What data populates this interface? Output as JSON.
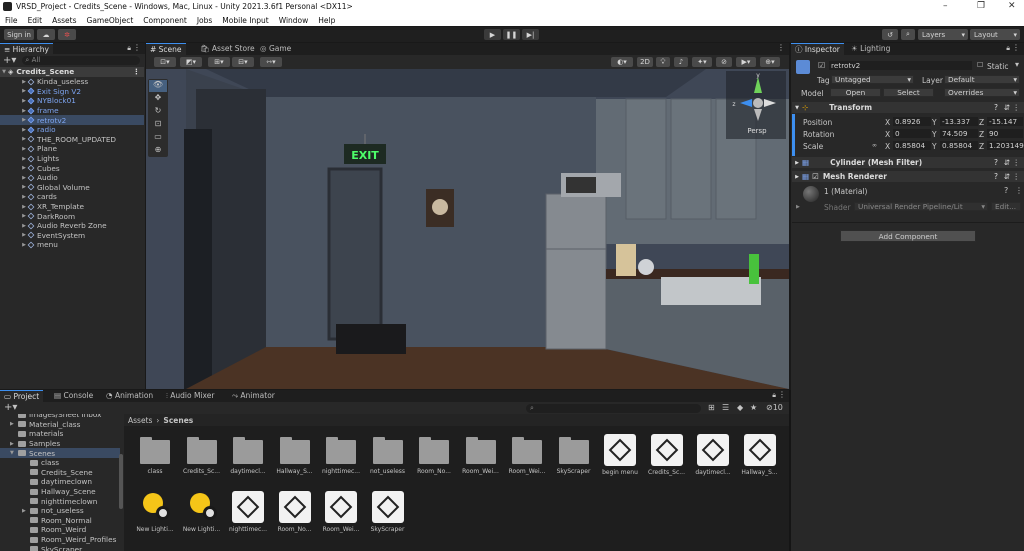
{
  "window": {
    "title": "VRSD_Project - Credits_Scene - Windows, Mac, Linux - Unity 2021.3.6f1 Personal <DX11>"
  },
  "menu": [
    "File",
    "Edit",
    "Assets",
    "GameObject",
    "Component",
    "Jobs",
    "Mobile Input",
    "Window",
    "Help"
  ],
  "toolbar": {
    "sign_in": "Sign in",
    "layers": "Layers",
    "layout": "Layout"
  },
  "hierarchy": {
    "tab": "Hierarchy",
    "search_placeholder": "All",
    "scene": "Credits_Scene",
    "items": [
      {
        "label": "Kinda_useless",
        "blue": false
      },
      {
        "label": "Exit Sign V2",
        "blue": true
      },
      {
        "label": "NYBlock01",
        "blue": true
      },
      {
        "label": "frame",
        "blue": true
      },
      {
        "label": "retrotv2",
        "blue": true,
        "selected": true
      },
      {
        "label": "radio",
        "blue": true
      },
      {
        "label": "THE_ROOM_UPDATED",
        "blue": false
      },
      {
        "label": "Plane",
        "blue": false
      },
      {
        "label": "Lights",
        "blue": false
      },
      {
        "label": "Cubes",
        "blue": false
      },
      {
        "label": "Audio",
        "blue": false
      },
      {
        "label": "Global Volume",
        "blue": false
      },
      {
        "label": "cards",
        "blue": false
      },
      {
        "label": "XR_Template",
        "blue": false
      },
      {
        "label": "DarkRoom",
        "blue": false
      },
      {
        "label": "Audio Reverb Zone",
        "blue": false
      },
      {
        "label": "EventSystem",
        "blue": false
      },
      {
        "label": "menu",
        "blue": false
      }
    ]
  },
  "scene_view": {
    "tabs": [
      "Scene",
      "Asset Store",
      "Game"
    ],
    "mode_2d": "2D",
    "gizmo_persp": "Persp",
    "gizmo_axes": {
      "y": "y",
      "z": "z"
    },
    "exit_sign": "EXIT"
  },
  "inspector": {
    "tabs": [
      "Inspector",
      "Lighting"
    ],
    "object_name": "retrotv2",
    "static": "Static",
    "tag_label": "Tag",
    "tag_value": "Untagged",
    "layer_label": "Layer",
    "layer_value": "Default",
    "model_label": "Model",
    "open": "Open",
    "select": "Select",
    "overrides": "Overrides",
    "transform": {
      "title": "Transform",
      "position_label": "Position",
      "position": {
        "x": "0.8926",
        "y": "-13.337",
        "z": "-15.147"
      },
      "rotation_label": "Rotation",
      "rotation": {
        "x": "0",
        "y": "74.509",
        "z": "90"
      },
      "scale_label": "Scale",
      "scale": {
        "x": "0.85804",
        "y": "0.85804",
        "z": "1.203149"
      }
    },
    "mesh_filter": "Cylinder (Mesh Filter)",
    "mesh_renderer": "Mesh Renderer",
    "material_name": "1 (Material)",
    "shader_label": "Shader",
    "shader_value": "Universal Render Pipeline/Lit",
    "edit": "Edit...",
    "add_component": "Add Component"
  },
  "bottom_tabs": [
    "Project",
    "Console",
    "Animation",
    "Audio Mixer",
    "Animator"
  ],
  "project": {
    "tree": [
      {
        "label": "Images/Sheet Inbox",
        "indent": 1,
        "arrow": false
      },
      {
        "label": "Material_class",
        "indent": 1,
        "arrow": true
      },
      {
        "label": "materials",
        "indent": 1,
        "arrow": false
      },
      {
        "label": "Samples",
        "indent": 1,
        "arrow": true
      },
      {
        "label": "Scenes",
        "indent": 1,
        "arrow": true,
        "selected": true
      },
      {
        "label": "class",
        "indent": 2,
        "arrow": false
      },
      {
        "label": "Credits_Scene",
        "indent": 2,
        "arrow": false
      },
      {
        "label": "daytimeclown",
        "indent": 2,
        "arrow": false
      },
      {
        "label": "Hallway_Scene",
        "indent": 2,
        "arrow": false
      },
      {
        "label": "nighttimeclown",
        "indent": 2,
        "arrow": false
      },
      {
        "label": "not_useless",
        "indent": 2,
        "arrow": true
      },
      {
        "label": "Room_Normal",
        "indent": 2,
        "arrow": false
      },
      {
        "label": "Room_Weird",
        "indent": 2,
        "arrow": false
      },
      {
        "label": "Room_Weird_Profiles",
        "indent": 2,
        "arrow": false
      },
      {
        "label": "SkyScraper",
        "indent": 2,
        "arrow": false
      }
    ],
    "breadcrumb": [
      "Assets",
      "Scenes"
    ],
    "hidden_count": "10",
    "assets": [
      {
        "label": "class",
        "type": "folder"
      },
      {
        "label": "Credits_Sc...",
        "type": "folder"
      },
      {
        "label": "daytimecl...",
        "type": "folder"
      },
      {
        "label": "Hallway_S...",
        "type": "folder"
      },
      {
        "label": "nighttimec...",
        "type": "folder"
      },
      {
        "label": "not_useless",
        "type": "folder"
      },
      {
        "label": "Room_No...",
        "type": "folder"
      },
      {
        "label": "Room_Wei...",
        "type": "folder"
      },
      {
        "label": "Room_Wei...",
        "type": "folder"
      },
      {
        "label": "SkyScraper",
        "type": "folder"
      },
      {
        "label": "begin menu",
        "type": "scene"
      },
      {
        "label": "Credits_Sc...",
        "type": "scene"
      },
      {
        "label": "daytimecl...",
        "type": "scene"
      },
      {
        "label": "Hallway_S...",
        "type": "scene"
      },
      {
        "label": "New Lighti...",
        "type": "light"
      },
      {
        "label": "New Lighti...",
        "type": "light"
      },
      {
        "label": "nighttimec...",
        "type": "scene"
      },
      {
        "label": "Room_No...",
        "type": "scene"
      },
      {
        "label": "Room_Wei...",
        "type": "scene"
      },
      {
        "label": "SkyScraper",
        "type": "scene"
      }
    ]
  },
  "colors": {
    "accent": "#3d8ff0",
    "selection": "#3a4a62",
    "prefab_blue": "#7da4f0",
    "exit_green": "#4dff6a"
  }
}
